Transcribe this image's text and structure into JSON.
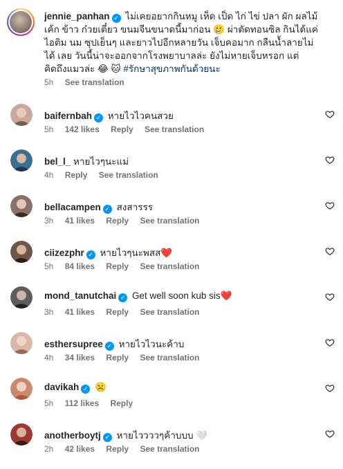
{
  "post": {
    "username": "jennie_panhan",
    "caption_body": "ไม่เคยอยากกินหมู เห็ด เป็ด ไก่ ไข่ ปลา ผัก ผลไม้ เค้ก ข้าว ก๋วยเตี๋ยว ขนมจีนขนาดนี้มาก่อน 🥲 ผ่าตัดทอนซิล กินได้แค่ ไอติม นม ซุปเย็นๆ และยาวไปอีกหลายวัน เจ็บคอมาก กลืนน้ำลายไม่ได้ เลย วันนี้น่าจะออกจากโรงพยาบาลล่ะ ยังไม่หายเจ็บหรอก แต่คิดถึงแมวล่ะ 😂 🐱",
    "hashtag": "#รักษาสุขภาพกันด้วยนะ",
    "time": "5h",
    "see_translation": "See translation"
  },
  "comments": [
    {
      "username": "baifernbah",
      "verified": true,
      "text": "หายไวไวคนสวย",
      "time": "5h",
      "likes": "142 likes",
      "reply": "Reply",
      "see_translation": "See translation"
    },
    {
      "username": "bel_l_",
      "verified": false,
      "text": "หายไวๆนะแม่",
      "time": "4h",
      "likes": "",
      "reply": "Reply",
      "see_translation": "See translation"
    },
    {
      "username": "bellacampen",
      "verified": true,
      "text": "สงสารรร",
      "time": "3h",
      "likes": "41 likes",
      "reply": "Reply",
      "see_translation": "See translation"
    },
    {
      "username": "ciizezphr",
      "verified": true,
      "text": "หายไวๆนะพสส",
      "text_suffix": "❤️",
      "time": "5h",
      "likes": "84 likes",
      "reply": "Reply",
      "see_translation": "See translation"
    },
    {
      "username": "mond_tanutchai",
      "verified": true,
      "text": "Get well soon kub sis",
      "text_suffix": "❤️",
      "time": "3h",
      "likes": "41 likes",
      "reply": "Reply",
      "see_translation": "See translation"
    },
    {
      "username": "esthersupree",
      "verified": true,
      "text": "หายไวไวนะค้าบ",
      "time": "4h",
      "likes": "34 likes",
      "reply": "Reply",
      "see_translation": "See translation"
    },
    {
      "username": "davikah",
      "verified": true,
      "text": "☹️",
      "time": "5h",
      "likes": "112 likes",
      "reply": "Reply",
      "see_translation": ""
    },
    {
      "username": "anotherboytj",
      "verified": true,
      "text": "หายไววววๆค้าบบบ 🤍",
      "time": "2h",
      "likes": "42 likes",
      "reply": "Reply",
      "see_translation": "See translation"
    }
  ],
  "colors": {
    "text": "#262626",
    "muted": "#737373",
    "verified": "#0095f6",
    "hashtag": "#00376b",
    "heart": "#e0245e"
  },
  "icons": {
    "like": "heart-outline-icon",
    "verified": "verified-badge-icon"
  }
}
